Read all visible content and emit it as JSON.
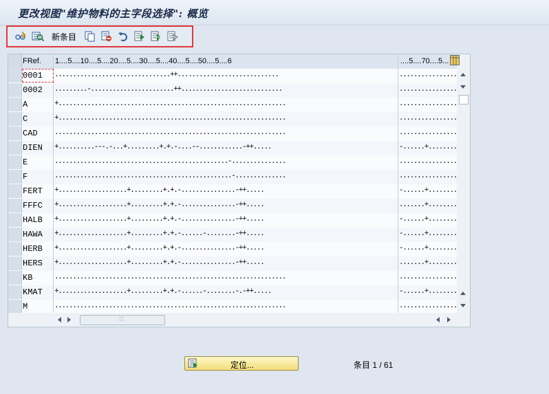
{
  "window": {
    "title": "更改视图\"维护物料的主字段选择\": 概览"
  },
  "toolbar": {
    "buttons": [
      {
        "icon": "glasses-edit-icon"
      },
      {
        "icon": "display-detail-icon"
      },
      {
        "label": "新条目"
      },
      {
        "icon": "copy-icon"
      },
      {
        "icon": "delete-icon"
      },
      {
        "icon": "undo-icon"
      },
      {
        "icon": "select-all-icon"
      },
      {
        "icon": "select-block-icon"
      },
      {
        "icon": "deselect-all-icon"
      }
    ]
  },
  "table": {
    "columns": [
      "FRef.",
      "1....5....10....5....20....5....30....5....40....5....50....5....6",
      "....5....70....5..."
    ],
    "rows": [
      {
        "key": "0001",
        "p1": "................................++............................",
        "p2": "................"
      },
      {
        "key": "0002",
        "p1": ".........-.......................++............................",
        "p2": "................"
      },
      {
        "key": "A",
        "p1": "+...............................................................",
        "p2": "................"
      },
      {
        "key": "C",
        "p1": "+...............................................................",
        "p2": "................"
      },
      {
        "key": "CAD",
        "p1": "................................................................",
        "p2": "................"
      },
      {
        "key": "DIEN",
        "p1": "+..........---.-...+.........+.+.-....--............-++.....",
        "p2": "-......+........"
      },
      {
        "key": "E",
        "p1": "................................................-...............",
        "p2": "................"
      },
      {
        "key": "F",
        "p1": ".................................................-..............",
        "p2": "................"
      },
      {
        "key": "FERT",
        "p1": "+...................+.........+.+.-...............-++.....",
        "p2": "-......+........"
      },
      {
        "key": "FFFC",
        "p1": "+...................+.........+.+.-...............-++.....",
        "p2": ".......+........"
      },
      {
        "key": "HALB",
        "p1": "+...................+.........+.+.-...............-++.....",
        "p2": "-......+........"
      },
      {
        "key": "HAWA",
        "p1": "+...................+.........+.+.-......-........-++.....",
        "p2": "-......+........"
      },
      {
        "key": "HERB",
        "p1": "+...................+.........+.+.-...............-++.....",
        "p2": "-......+........"
      },
      {
        "key": "HERS",
        "p1": "+...................+.........+.+.-...............-++.....",
        "p2": ".......+........"
      },
      {
        "key": "KB",
        "p1": "................................................................",
        "p2": "................"
      },
      {
        "key": "KMAT",
        "p1": "+...................+.........+.+.-......-........-.-++.....",
        "p2": "-......+........"
      },
      {
        "key": "M",
        "p1": "................................................................",
        "p2": "................"
      }
    ]
  },
  "footer": {
    "position_button": "定位...",
    "entry_counter": "条目 1 / 61"
  },
  "colors": {
    "highlight": "#e2373a",
    "button": "#f2dd78",
    "background": "#dfe6ef"
  }
}
